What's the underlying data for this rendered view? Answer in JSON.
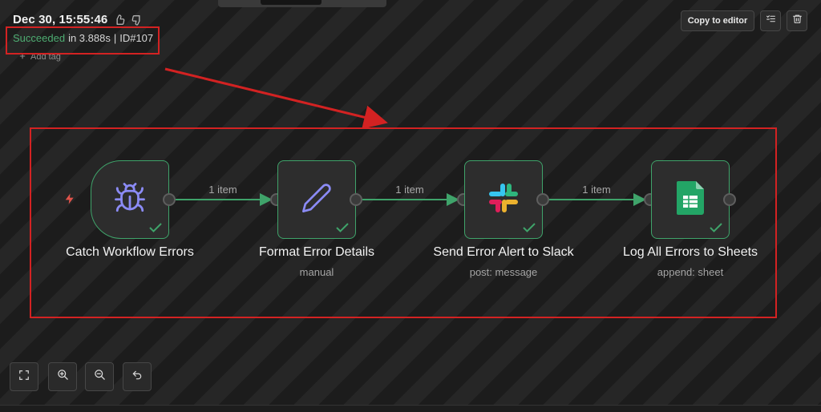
{
  "header": {
    "date": "Dec 30, 15:55:46",
    "status": "Succeeded",
    "duration": "in 3.888s",
    "separator": "|",
    "execution_id": "ID#107",
    "add_tag": "Add tag",
    "icons": [
      "thumbs-up-icon",
      "thumbs-down-icon",
      "plus-icon"
    ]
  },
  "toolbar": {
    "copy_label": "Copy to editor",
    "icons": [
      "list-check-icon",
      "trash-icon"
    ]
  },
  "nodes": [
    {
      "name": "Catch Workflow Errors",
      "subtitle": "",
      "icon": "bug-icon"
    },
    {
      "name": "Format Error Details",
      "subtitle": "manual",
      "icon": "pen-icon"
    },
    {
      "name": "Send Error Alert to Slack",
      "subtitle": "post: message",
      "icon": "slack-logo-icon"
    },
    {
      "name": "Log All Errors to Sheets",
      "subtitle": "append: sheet",
      "icon": "google-sheets-icon"
    }
  ],
  "edges": [
    {
      "label": "1 item"
    },
    {
      "label": "1 item"
    },
    {
      "label": "1 item"
    }
  ],
  "zoom_controls": [
    "fit-view-icon",
    "zoom-in-icon",
    "zoom-out-icon",
    "reset-icon"
  ],
  "colors": {
    "success": "#4ead72",
    "node_border": "#3fa36a",
    "annotation": "#d32222",
    "trigger_bolt": "#e0534a",
    "bug_icon": "#8b8bf5"
  }
}
